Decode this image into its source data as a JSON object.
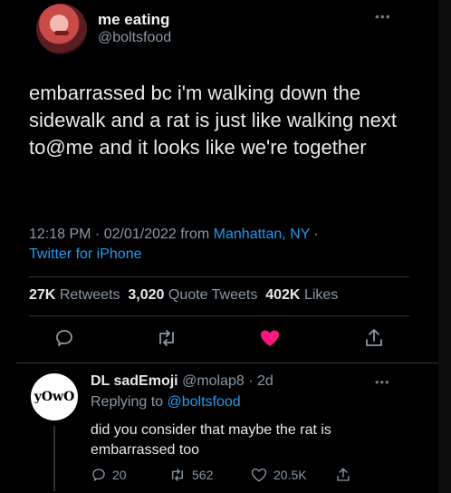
{
  "tweet": {
    "display_name": "me eating",
    "handle": "@boltsfood",
    "text": "embarrassed bc i'm walking down the sidewalk and a rat is just like walking next to@me and it looks like we're together",
    "time": "12:18 PM · 02/01/2022 from ",
    "location": "Manhattan, NY",
    "separator": " · ",
    "client": "Twitter for iPhone",
    "more_icon": "more-dots-icon"
  },
  "stats": {
    "retweets_count": "27K",
    "retweets_label": "Retweets",
    "quotes_count": "3,020",
    "quotes_label": "Quote Tweets",
    "likes_count": "402K",
    "likes_label": "Likes"
  },
  "actions": {
    "reply_icon": "reply-icon",
    "retweet_icon": "retweet-icon",
    "like_icon": "heart-icon",
    "share_icon": "share-icon",
    "liked": true,
    "like_color": "#f91880"
  },
  "reply": {
    "avatar_text": "yOwO",
    "display_name": "DL sadEmoji",
    "handle": "@molap8",
    "dot": " · ",
    "age": "2d",
    "replying_prefix": "Replying to ",
    "replying_to": "@boltsfood",
    "text": "did you consider that maybe the rat is embarrassed too",
    "reply_count": "20",
    "retweet_count": "562",
    "like_count": "20.5K"
  },
  "colors": {
    "background": "#000000",
    "link": "#1d9bf0",
    "muted": "#8b98a5",
    "text": "#e7e9ea"
  }
}
